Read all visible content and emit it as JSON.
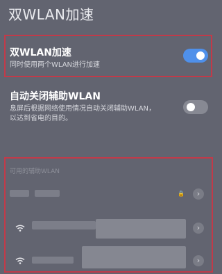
{
  "page": {
    "title": "双WLAN加速"
  },
  "dual_wlan": {
    "title": "双WLAN加速",
    "subtitle": "同时使用两个WLAN进行加速",
    "enabled": true
  },
  "auto_close": {
    "title": "自动关闭辅助WLAN",
    "subtitle_line1": "息屏后根据网络使用情况自动关闭辅助WLAN，",
    "subtitle_line2": "以达到省电的目的。",
    "enabled": false
  },
  "available": {
    "header": "可用的辅助WLAN",
    "networks": [
      {
        "icon": "lock-icon",
        "secured": true
      },
      {
        "icon": "wifi-icon",
        "secured": true
      },
      {
        "icon": "wifi-icon",
        "secured": false
      }
    ]
  },
  "colors": {
    "background": "#626470",
    "accent": "#4f90ea",
    "highlight": "#c23a49"
  }
}
